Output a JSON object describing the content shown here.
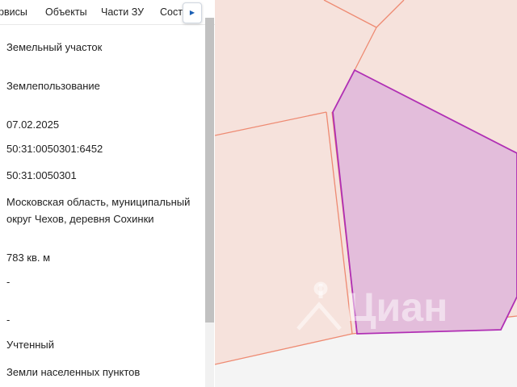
{
  "tabs": [
    "рвисы",
    "Объекты",
    "Части ЗУ",
    "Соста"
  ],
  "tab_next_icon": "chevron-right-icon",
  "details": [
    "Земельный участок",
    "Землепользование",
    "07.02.2025",
    "50:31:0050301:6452",
    "50:31:0050301",
    "Московская область, муниципальный округ Чехов, деревня Сохинки",
    "783 кв. м",
    "-",
    "-",
    "Учтенный",
    "Земли населенных пунктов"
  ],
  "map": {
    "watermark": "Циан",
    "colors": {
      "background": "#f6e2dc",
      "parcel_border": "#ee8a72",
      "selected_fill": "#e3bddb",
      "selected_border": "#b02fb4",
      "road": "#f4f4f4"
    }
  }
}
